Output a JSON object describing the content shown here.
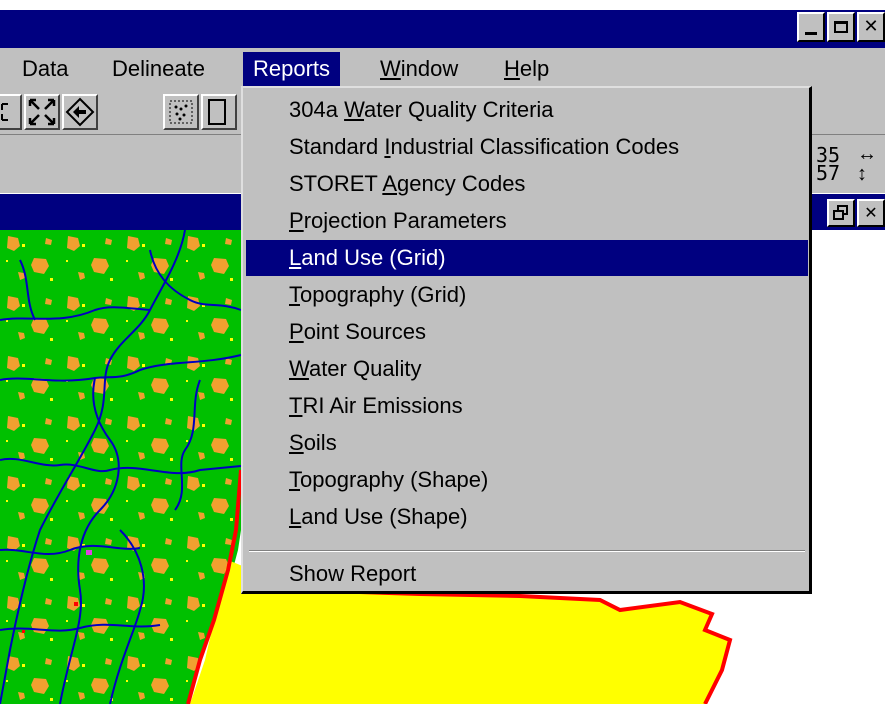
{
  "menubar": {
    "items": [
      {
        "label": "Data"
      },
      {
        "label": "Delineate"
      },
      {
        "label": "Reports"
      },
      {
        "label": "Window",
        "mn": "W",
        "rest": "indow"
      },
      {
        "label": "Help",
        "mn": "H",
        "rest": "elp"
      }
    ]
  },
  "status": {
    "coord_top": "35",
    "coord_bottom": "57"
  },
  "reports_menu": {
    "items": [
      {
        "pre": "304a ",
        "mn": "W",
        "post": "ater Quality Criteria"
      },
      {
        "pre": "Standard ",
        "mn": "I",
        "post": "ndustrial Classification Codes"
      },
      {
        "pre": "STORET ",
        "mn": "A",
        "post": "gency Codes"
      },
      {
        "pre": "",
        "mn": "P",
        "post": "rojection Parameters"
      },
      {
        "pre": "",
        "mn": "L",
        "post": "and Use (Grid)"
      },
      {
        "pre": "",
        "mn": "T",
        "post": "opography (Grid)"
      },
      {
        "pre": "",
        "mn": "P",
        "post": "oint Sources"
      },
      {
        "pre": "",
        "mn": "W",
        "post": "ater Quality"
      },
      {
        "pre": "",
        "mn": "T",
        "post": "RI Air Emissions"
      },
      {
        "pre": "",
        "mn": "S",
        "post": "oils"
      },
      {
        "pre": "",
        "mn": "T",
        "post": "opography (Shape)"
      },
      {
        "pre": "",
        "mn": "L",
        "post": "and Use (Shape)"
      }
    ],
    "show_report": "Show Report",
    "highlighted_index": 4
  },
  "colors": {
    "titlebar": "#000080",
    "face": "#c0c0c0",
    "land_green": "#00c000",
    "land_orange": "#f0a030",
    "land_yellow": "#ffff00",
    "river_blue": "#0000c0",
    "boundary_red": "#ff0000"
  }
}
